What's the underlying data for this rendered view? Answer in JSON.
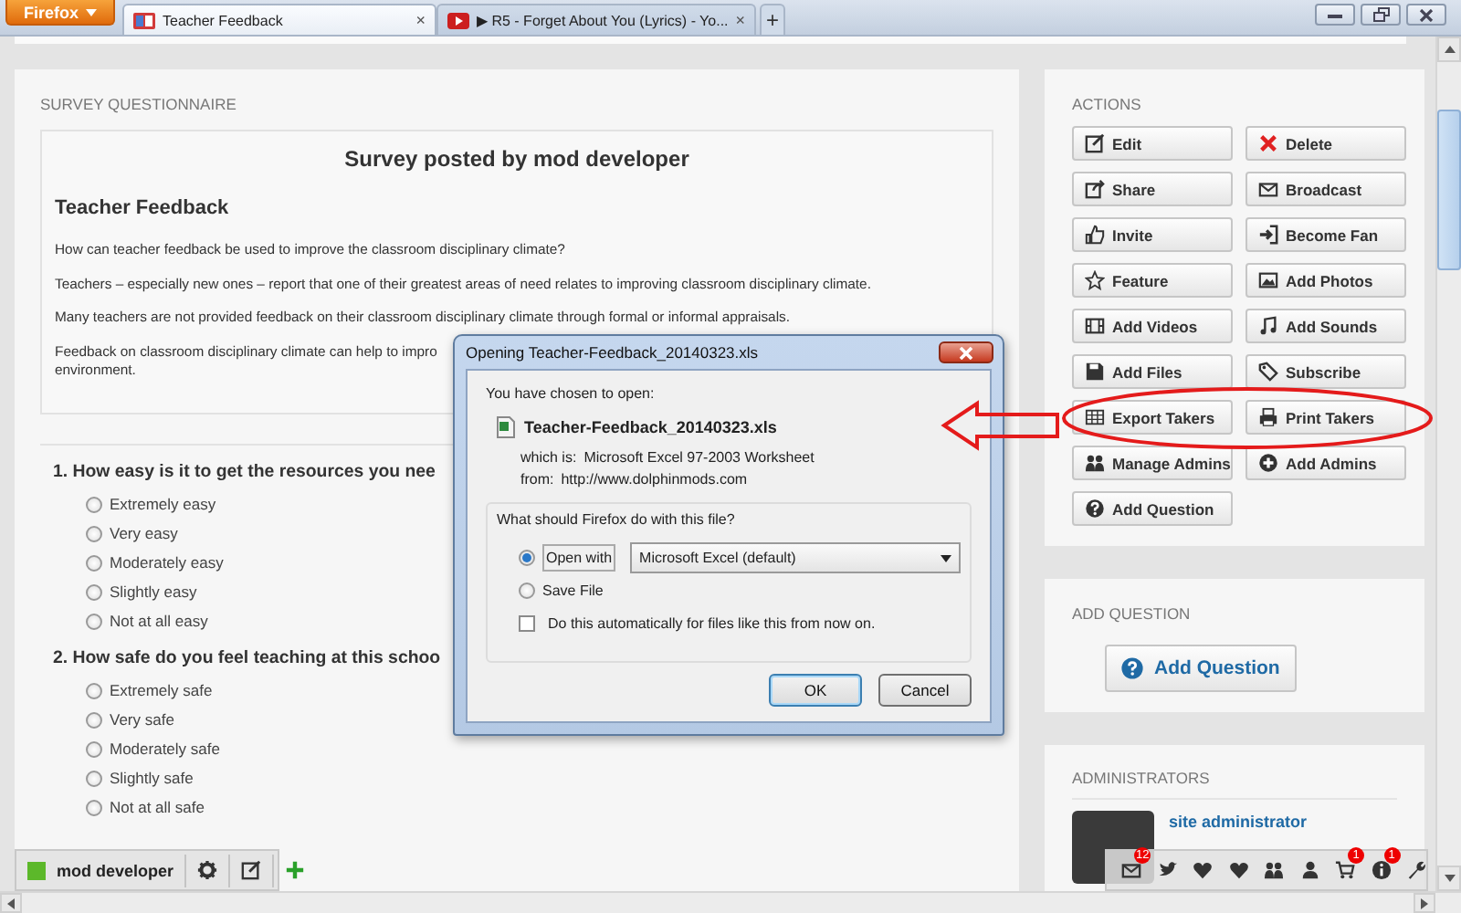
{
  "browser": {
    "menu_button": "Firefox",
    "tabs": [
      {
        "title": "Teacher Feedback",
        "selected": true,
        "close": "×"
      },
      {
        "title": "▶ R5 - Forget About You (Lyrics) - Yo...",
        "selected": false,
        "close": "×"
      }
    ],
    "new_tab": "+"
  },
  "survey": {
    "section_label": "SURVEY QUESTIONNAIRE",
    "heading": "Survey posted by mod developer",
    "title": "Teacher Feedback",
    "paragraphs": [
      {
        "lines": [
          "How can teacher feedback be used to improve the classroom disciplinary climate?"
        ]
      },
      {
        "lines": [
          "Teachers – especially new ones – report that one of their greatest areas of need relates to improving classroom disciplinary climate."
        ]
      },
      {
        "lines": [
          "Many teachers are not provided feedback on their classroom disciplinary climate through formal or informal appraisals."
        ]
      },
      {
        "lines": [
          "Feedback on classroom disciplinary climate can help to impro",
          "environment."
        ]
      }
    ],
    "questions": [
      {
        "text": "1. How easy is it to get the resources you nee",
        "options": [
          {
            "label": "Extremely easy",
            "selected": false
          },
          {
            "label": "Very easy",
            "selected": false
          },
          {
            "label": "Moderately easy",
            "selected": false
          },
          {
            "label": "Slightly easy",
            "selected": false
          },
          {
            "label": "Not at all easy",
            "selected": false
          }
        ]
      },
      {
        "text": "2. How safe do you feel teaching at this schoo",
        "options": [
          {
            "label": "Extremely safe",
            "selected": false
          },
          {
            "label": "Very safe",
            "selected": false
          },
          {
            "label": "Moderately safe",
            "selected": false
          },
          {
            "label": "Slightly safe",
            "selected": false
          },
          {
            "label": "Not at all safe",
            "selected": false
          }
        ]
      }
    ]
  },
  "sidebar": {
    "actions": {
      "label": "ACTIONS",
      "buttons": [
        {
          "label": "Edit",
          "kind": "edit"
        },
        {
          "label": "Delete",
          "kind": "delete"
        },
        {
          "label": "Share",
          "kind": "share"
        },
        {
          "label": "Broadcast",
          "kind": "broadcast"
        },
        {
          "label": "Invite",
          "kind": "invite"
        },
        {
          "label": "Become Fan",
          "kind": "fan"
        },
        {
          "label": "Feature",
          "kind": "feature"
        },
        {
          "label": "Add Photos",
          "kind": "photos"
        },
        {
          "label": "Add Videos",
          "kind": "videos"
        },
        {
          "label": "Add Sounds",
          "kind": "sounds"
        },
        {
          "label": "Add Files",
          "kind": "files"
        },
        {
          "label": "Subscribe",
          "kind": "subscribe"
        },
        {
          "label": "Export Takers",
          "kind": "export"
        },
        {
          "label": "Print Takers",
          "kind": "print"
        },
        {
          "label": "Manage Admins",
          "kind": "admins"
        },
        {
          "label": "Add Admins",
          "kind": "add"
        },
        {
          "label": "Add Question",
          "kind": "question"
        }
      ]
    },
    "add_question": {
      "label": "ADD QUESTION",
      "button": "Add Question"
    },
    "administrators": {
      "label": "ADMINISTRATORS",
      "admins": [
        {
          "name": "site administrator"
        }
      ]
    }
  },
  "toolbar": {
    "user": "mod developer",
    "icons": [
      {
        "kind": "mail",
        "badge": "12"
      },
      {
        "kind": "bird"
      },
      {
        "kind": "heart"
      },
      {
        "kind": "heart"
      },
      {
        "kind": "group"
      },
      {
        "kind": "person"
      },
      {
        "kind": "cart",
        "badge": "1"
      },
      {
        "kind": "info",
        "badge": "1"
      },
      {
        "kind": "wrench"
      }
    ]
  },
  "dialog": {
    "title": "Opening Teacher-Feedback_20140323.xls",
    "intro": "You have chosen to open:",
    "file_name": "Teacher-Feedback_20140323.xls",
    "type_label": "which is:",
    "type": "Microsoft Excel 97-2003 Worksheet",
    "from_label": "from:",
    "from": "http://www.dolphinmods.com",
    "question": "What should Firefox do with this file?",
    "choices": [
      {
        "label": "Open with",
        "selected": true
      },
      {
        "label": "Save File",
        "selected": false
      }
    ],
    "app": "Microsoft Excel (default)",
    "auto": {
      "label": "Do this automatically for files like this from now on.",
      "checked": false
    },
    "buttons": [
      "OK",
      "Cancel"
    ]
  }
}
